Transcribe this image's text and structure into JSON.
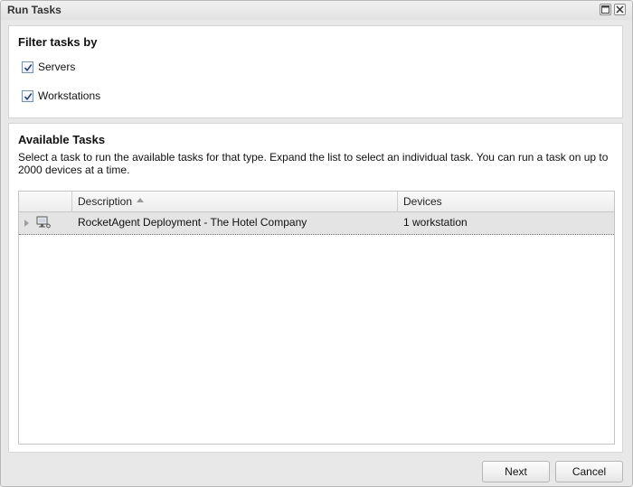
{
  "window": {
    "title": "Run Tasks",
    "maximize_icon": "maximize-icon",
    "close_icon": "close-icon"
  },
  "filter": {
    "heading": "Filter tasks by",
    "options": [
      {
        "label": "Servers",
        "checked": true
      },
      {
        "label": "Workstations",
        "checked": true
      }
    ]
  },
  "tasks": {
    "heading": "Available Tasks",
    "description": "Select a task to run the available tasks for that type. Expand the list to select an individual task. You can run a task on up to 2000 devices at a time.",
    "columns": [
      "",
      "Description",
      "Devices"
    ],
    "sort": {
      "column": "Description",
      "direction": "ascending"
    },
    "rows": [
      {
        "icon": "workstation-icon",
        "description": "RocketAgent Deployment - The Hotel Company",
        "devices": "1 workstation",
        "expanded": false,
        "selected": true
      }
    ]
  },
  "buttons": {
    "next": "Next",
    "cancel": "Cancel"
  },
  "colors": {
    "selected_row": "#e4e4e4",
    "dialog_background": "#e8e8e8"
  }
}
